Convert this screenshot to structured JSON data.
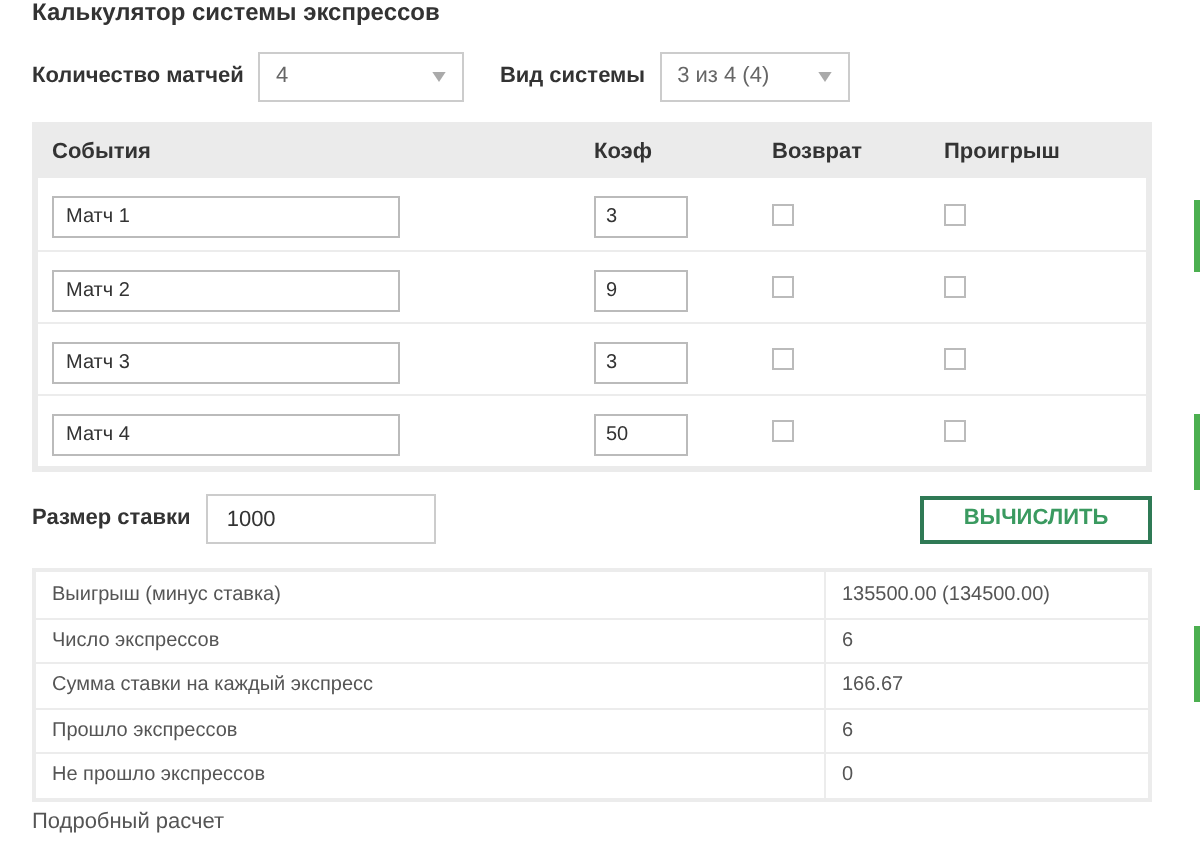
{
  "title": "Калькулятор системы экспрессов",
  "controls": [
    {
      "label": "Количество матчей",
      "value": "4"
    },
    {
      "label": "Вид системы",
      "value": "3 из 4 (4)"
    }
  ],
  "events_table": {
    "columns": [
      "События",
      "Коэф",
      "Возврат",
      "Проигрыш"
    ],
    "rows": [
      {
        "event": "Матч 1",
        "odds": "3",
        "refund": false,
        "loss": false
      },
      {
        "event": "Матч 2",
        "odds": "9",
        "refund": false,
        "loss": false
      },
      {
        "event": "Матч 3",
        "odds": "3",
        "refund": false,
        "loss": false
      },
      {
        "event": "Матч 4",
        "odds": "50",
        "refund": false,
        "loss": false
      }
    ]
  },
  "stake": {
    "label": "Размер ставки",
    "value": "1000"
  },
  "calculate_button": "ВЫЧИСЛИТЬ",
  "results": [
    {
      "label": "Выигрыш (минус ставка)",
      "value": "135500.00 (134500.00)"
    },
    {
      "label": "Число экспрессов",
      "value": "6"
    },
    {
      "label": "Сумма ставки на каждый экспресс",
      "value": "166.67"
    },
    {
      "label": "Прошло экспрессов",
      "value": "6"
    },
    {
      "label": "Не прошло экспрессов",
      "value": "0"
    }
  ],
  "details_link": "Подробный расчет"
}
